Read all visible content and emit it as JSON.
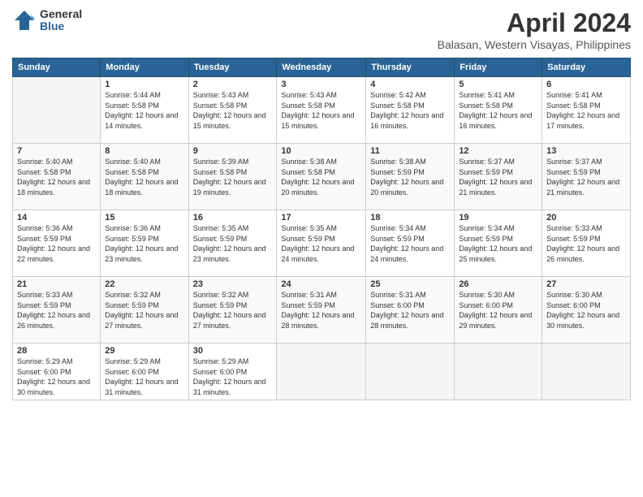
{
  "logo": {
    "general": "General",
    "blue": "Blue"
  },
  "header": {
    "title": "April 2024",
    "subtitle": "Balasan, Western Visayas, Philippines"
  },
  "weekdays": [
    "Sunday",
    "Monday",
    "Tuesday",
    "Wednesday",
    "Thursday",
    "Friday",
    "Saturday"
  ],
  "weeks": [
    [
      {
        "day": "",
        "sunrise": "",
        "sunset": "",
        "daylight": ""
      },
      {
        "day": "1",
        "sunrise": "Sunrise: 5:44 AM",
        "sunset": "Sunset: 5:58 PM",
        "daylight": "Daylight: 12 hours and 14 minutes."
      },
      {
        "day": "2",
        "sunrise": "Sunrise: 5:43 AM",
        "sunset": "Sunset: 5:58 PM",
        "daylight": "Daylight: 12 hours and 15 minutes."
      },
      {
        "day": "3",
        "sunrise": "Sunrise: 5:43 AM",
        "sunset": "Sunset: 5:58 PM",
        "daylight": "Daylight: 12 hours and 15 minutes."
      },
      {
        "day": "4",
        "sunrise": "Sunrise: 5:42 AM",
        "sunset": "Sunset: 5:58 PM",
        "daylight": "Daylight: 12 hours and 16 minutes."
      },
      {
        "day": "5",
        "sunrise": "Sunrise: 5:41 AM",
        "sunset": "Sunset: 5:58 PM",
        "daylight": "Daylight: 12 hours and 16 minutes."
      },
      {
        "day": "6",
        "sunrise": "Sunrise: 5:41 AM",
        "sunset": "Sunset: 5:58 PM",
        "daylight": "Daylight: 12 hours and 17 minutes."
      }
    ],
    [
      {
        "day": "7",
        "sunrise": "Sunrise: 5:40 AM",
        "sunset": "Sunset: 5:58 PM",
        "daylight": "Daylight: 12 hours and 18 minutes."
      },
      {
        "day": "8",
        "sunrise": "Sunrise: 5:40 AM",
        "sunset": "Sunset: 5:58 PM",
        "daylight": "Daylight: 12 hours and 18 minutes."
      },
      {
        "day": "9",
        "sunrise": "Sunrise: 5:39 AM",
        "sunset": "Sunset: 5:58 PM",
        "daylight": "Daylight: 12 hours and 19 minutes."
      },
      {
        "day": "10",
        "sunrise": "Sunrise: 5:38 AM",
        "sunset": "Sunset: 5:58 PM",
        "daylight": "Daylight: 12 hours and 20 minutes."
      },
      {
        "day": "11",
        "sunrise": "Sunrise: 5:38 AM",
        "sunset": "Sunset: 5:59 PM",
        "daylight": "Daylight: 12 hours and 20 minutes."
      },
      {
        "day": "12",
        "sunrise": "Sunrise: 5:37 AM",
        "sunset": "Sunset: 5:59 PM",
        "daylight": "Daylight: 12 hours and 21 minutes."
      },
      {
        "day": "13",
        "sunrise": "Sunrise: 5:37 AM",
        "sunset": "Sunset: 5:59 PM",
        "daylight": "Daylight: 12 hours and 21 minutes."
      }
    ],
    [
      {
        "day": "14",
        "sunrise": "Sunrise: 5:36 AM",
        "sunset": "Sunset: 5:59 PM",
        "daylight": "Daylight: 12 hours and 22 minutes."
      },
      {
        "day": "15",
        "sunrise": "Sunrise: 5:36 AM",
        "sunset": "Sunset: 5:59 PM",
        "daylight": "Daylight: 12 hours and 23 minutes."
      },
      {
        "day": "16",
        "sunrise": "Sunrise: 5:35 AM",
        "sunset": "Sunset: 5:59 PM",
        "daylight": "Daylight: 12 hours and 23 minutes."
      },
      {
        "day": "17",
        "sunrise": "Sunrise: 5:35 AM",
        "sunset": "Sunset: 5:59 PM",
        "daylight": "Daylight: 12 hours and 24 minutes."
      },
      {
        "day": "18",
        "sunrise": "Sunrise: 5:34 AM",
        "sunset": "Sunset: 5:59 PM",
        "daylight": "Daylight: 12 hours and 24 minutes."
      },
      {
        "day": "19",
        "sunrise": "Sunrise: 5:34 AM",
        "sunset": "Sunset: 5:59 PM",
        "daylight": "Daylight: 12 hours and 25 minutes."
      },
      {
        "day": "20",
        "sunrise": "Sunrise: 5:33 AM",
        "sunset": "Sunset: 5:59 PM",
        "daylight": "Daylight: 12 hours and 26 minutes."
      }
    ],
    [
      {
        "day": "21",
        "sunrise": "Sunrise: 5:33 AM",
        "sunset": "Sunset: 5:59 PM",
        "daylight": "Daylight: 12 hours and 26 minutes."
      },
      {
        "day": "22",
        "sunrise": "Sunrise: 5:32 AM",
        "sunset": "Sunset: 5:59 PM",
        "daylight": "Daylight: 12 hours and 27 minutes."
      },
      {
        "day": "23",
        "sunrise": "Sunrise: 5:32 AM",
        "sunset": "Sunset: 5:59 PM",
        "daylight": "Daylight: 12 hours and 27 minutes."
      },
      {
        "day": "24",
        "sunrise": "Sunrise: 5:31 AM",
        "sunset": "Sunset: 5:59 PM",
        "daylight": "Daylight: 12 hours and 28 minutes."
      },
      {
        "day": "25",
        "sunrise": "Sunrise: 5:31 AM",
        "sunset": "Sunset: 6:00 PM",
        "daylight": "Daylight: 12 hours and 28 minutes."
      },
      {
        "day": "26",
        "sunrise": "Sunrise: 5:30 AM",
        "sunset": "Sunset: 6:00 PM",
        "daylight": "Daylight: 12 hours and 29 minutes."
      },
      {
        "day": "27",
        "sunrise": "Sunrise: 5:30 AM",
        "sunset": "Sunset: 6:00 PM",
        "daylight": "Daylight: 12 hours and 30 minutes."
      }
    ],
    [
      {
        "day": "28",
        "sunrise": "Sunrise: 5:29 AM",
        "sunset": "Sunset: 6:00 PM",
        "daylight": "Daylight: 12 hours and 30 minutes."
      },
      {
        "day": "29",
        "sunrise": "Sunrise: 5:29 AM",
        "sunset": "Sunset: 6:00 PM",
        "daylight": "Daylight: 12 hours and 31 minutes."
      },
      {
        "day": "30",
        "sunrise": "Sunrise: 5:29 AM",
        "sunset": "Sunset: 6:00 PM",
        "daylight": "Daylight: 12 hours and 31 minutes."
      },
      {
        "day": "",
        "sunrise": "",
        "sunset": "",
        "daylight": ""
      },
      {
        "day": "",
        "sunrise": "",
        "sunset": "",
        "daylight": ""
      },
      {
        "day": "",
        "sunrise": "",
        "sunset": "",
        "daylight": ""
      },
      {
        "day": "",
        "sunrise": "",
        "sunset": "",
        "daylight": ""
      }
    ]
  ]
}
